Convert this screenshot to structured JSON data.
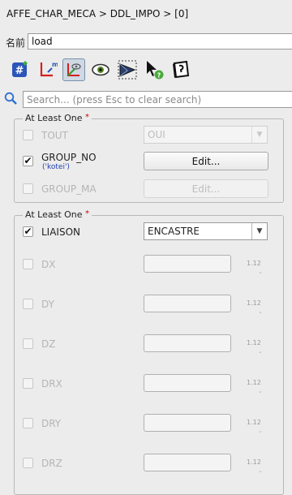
{
  "breadcrumb": "AFFE_CHAR_MECA > DDL_IMPO > [0]",
  "name_field": {
    "label": "名前",
    "value": "load"
  },
  "toolbar": {
    "icons": [
      "hash-icon",
      "axis-icon",
      "select-geometry-icon",
      "eye-icon",
      "mesh-view-icon",
      "pointer-help-icon",
      "edit-book-icon"
    ]
  },
  "search": {
    "placeholder": "Search... (press Esc to clear search)"
  },
  "group1": {
    "title": "At Least One",
    "required_mark": "*",
    "rows": [
      {
        "label": "TOUT",
        "checked": false,
        "enabled": false,
        "control_value": "OUI"
      },
      {
        "label": "GROUP_NO",
        "sublabel": "('kotei')",
        "checked": true,
        "enabled": true,
        "button_label": "Edit...",
        "check_mark": "✔"
      },
      {
        "label": "GROUP_MA",
        "checked": false,
        "enabled": false,
        "button_label": "Edit..."
      }
    ]
  },
  "group2": {
    "title": "At Least One",
    "required_mark": "*",
    "liaison": {
      "label": "LIAISON",
      "checked": true,
      "value": "ENCASTRE",
      "check_mark": "✔"
    },
    "spin_label": "1.12",
    "rows": [
      {
        "label": "DX",
        "checked": false
      },
      {
        "label": "DY",
        "checked": false
      },
      {
        "label": "DZ",
        "checked": false
      },
      {
        "label": "DRX",
        "checked": false
      },
      {
        "label": "DRY",
        "checked": false
      },
      {
        "label": "DRZ",
        "checked": false
      }
    ]
  }
}
